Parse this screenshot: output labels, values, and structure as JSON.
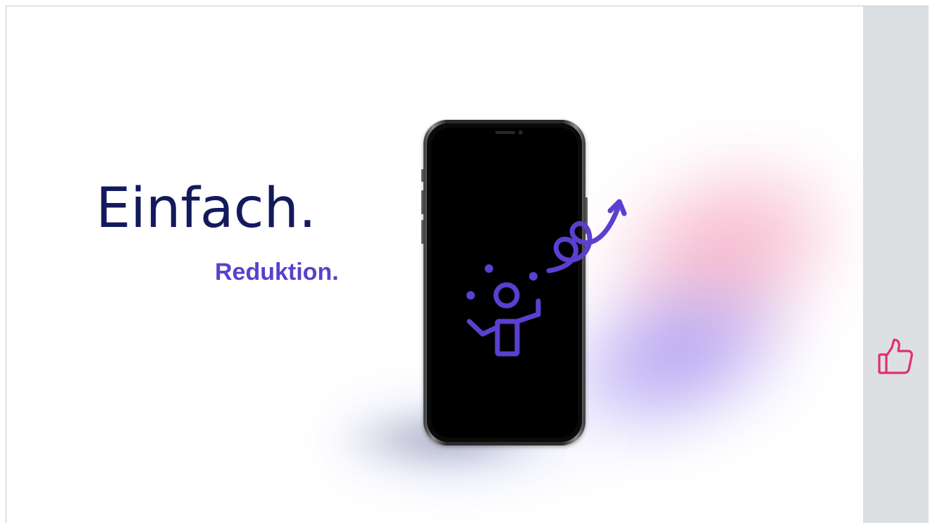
{
  "slide": {
    "headline": "Einfach.",
    "subheadline": "Reduktion."
  },
  "sidebar": {
    "like_icon": "thumbs-up-icon"
  },
  "colors": {
    "headline": "#131a5c",
    "accent": "#5b3fd0",
    "like": "#e0306c",
    "sidebar_bg": "#dde0e3"
  },
  "icons": {
    "illustration": "juggler-icon"
  }
}
